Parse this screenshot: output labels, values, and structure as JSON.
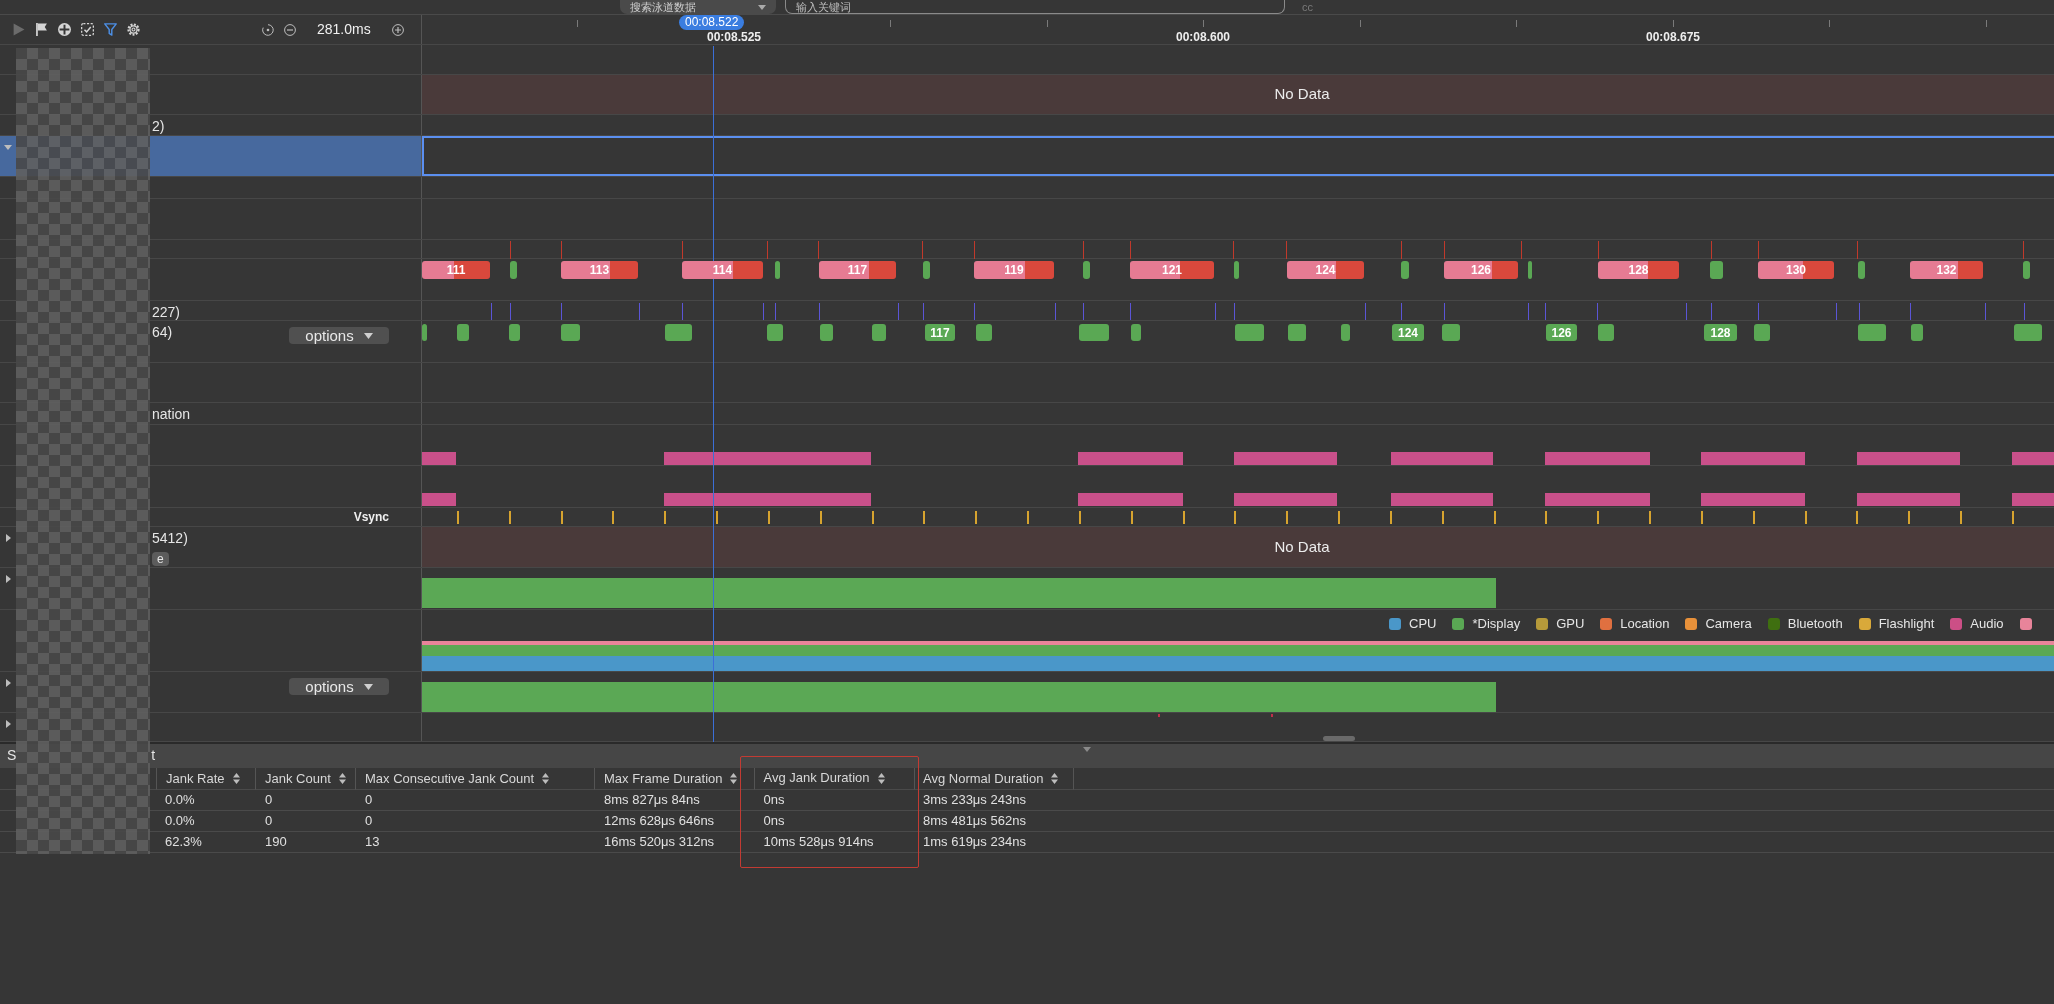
{
  "search_bar": {
    "lane_select": "搜索泳道数据",
    "keyword_field": {
      "placeholder": "输入关键词"
    },
    "trailing_text": "cc"
  },
  "toolbar": {
    "tools": [
      {
        "kind": "play",
        "disabled": true,
        "active": false
      },
      {
        "kind": "flag",
        "disabled": false,
        "active": false
      },
      {
        "kind": "crosshair",
        "disabled": false,
        "active": false
      },
      {
        "kind": "region_select",
        "disabled": false,
        "active": false
      },
      {
        "kind": "filter",
        "disabled": false,
        "active": true
      },
      {
        "kind": "settings",
        "disabled": false,
        "active": false
      }
    ],
    "zoom_reading": "281.0ms"
  },
  "timeline": {
    "cursor": "00:08.522",
    "ticks": [
      "00:08.525",
      "00:08.600",
      "00:08.675"
    ]
  },
  "tracks": [
    {
      "kind": "blank",
      "selected": false
    },
    {
      "kind": "no_data",
      "selected": false,
      "message": "No Data"
    },
    {
      "kind": "blank",
      "selected": false,
      "label": "2)"
    },
    {
      "kind": "blank",
      "selected": true,
      "expanded": true
    },
    {
      "kind": "blank",
      "selected": false
    },
    {
      "kind": "blank",
      "selected": false
    },
    {
      "kind": "red_ticks",
      "selected": false
    },
    {
      "kind": "split_slices",
      "selected": false,
      "slices": [
        {
          "kind": "jank",
          "label": "111"
        },
        {
          "kind": "normal"
        },
        {
          "kind": "jank",
          "label": "113"
        },
        {
          "kind": "jank",
          "label": "114"
        },
        {
          "kind": "normal"
        },
        {
          "kind": "jank",
          "label": "117"
        },
        {
          "kind": "normal"
        },
        {
          "kind": "jank",
          "label": "119"
        },
        {
          "kind": "normal"
        },
        {
          "kind": "jank",
          "label": "121"
        },
        {
          "kind": "normal"
        },
        {
          "kind": "jank",
          "label": "124"
        },
        {
          "kind": "normal"
        },
        {
          "kind": "jank",
          "label": "126"
        },
        {
          "kind": "normal"
        },
        {
          "kind": "jank",
          "label": "128"
        },
        {
          "kind": "normal"
        },
        {
          "kind": "jank",
          "label": "130"
        },
        {
          "kind": "normal"
        },
        {
          "kind": "jank",
          "label": "132"
        },
        {
          "kind": "normal"
        }
      ]
    },
    {
      "kind": "purple_ticks",
      "selected": false,
      "label": "227)"
    },
    {
      "kind": "green_slices",
      "selected": false,
      "label": "64)",
      "options": "options",
      "slices": [
        {
          "kind": "normal"
        },
        {
          "kind": "normal"
        },
        {
          "kind": "normal"
        },
        {
          "kind": "normal"
        },
        {
          "kind": "normal"
        },
        {
          "kind": "normal"
        },
        {
          "kind": "normal"
        },
        {
          "kind": "normal"
        },
        {
          "kind": "normal",
          "label": "117"
        },
        {
          "kind": "normal"
        },
        {
          "kind": "normal"
        },
        {
          "kind": "normal"
        },
        {
          "kind": "normal"
        },
        {
          "kind": "normal"
        },
        {
          "kind": "normal"
        },
        {
          "kind": "normal",
          "label": "124"
        },
        {
          "kind": "normal"
        },
        {
          "kind": "normal",
          "label": "126"
        },
        {
          "kind": "normal"
        },
        {
          "kind": "normal",
          "label": "128"
        },
        {
          "kind": "normal"
        },
        {
          "kind": "normal"
        },
        {
          "kind": "normal"
        },
        {
          "kind": "normal"
        }
      ]
    },
    {
      "kind": "blank",
      "selected": false
    },
    {
      "kind": "blank",
      "selected": false,
      "label": "nation"
    },
    {
      "kind": "pink_bars",
      "selected": false
    },
    {
      "kind": "pink_bars",
      "selected": false
    },
    {
      "kind": "vsync",
      "selected": false,
      "title": "Vsync"
    },
    {
      "kind": "no_data",
      "selected": false,
      "label": "5412)",
      "tag": "e",
      "expanded": false,
      "message": "No Data"
    },
    {
      "kind": "green_bar",
      "selected": false,
      "expanded": false
    },
    {
      "kind": "stacked",
      "selected": false,
      "legend": [
        {
          "label": "CPU",
          "color": "#4a97c9"
        },
        {
          "label": "*Display",
          "color": "#5aa854"
        },
        {
          "label": "GPU",
          "color": "#b69a3a"
        },
        {
          "label": "Location",
          "color": "#e07040"
        },
        {
          "label": "Camera",
          "color": "#e8913a"
        },
        {
          "label": "Bluetooth",
          "color": "#3f6f10"
        },
        {
          "label": "Flashlight",
          "color": "#d9a93a"
        },
        {
          "label": "Audio",
          "color": "#cc4f86"
        },
        {
          "color": "#e8849a"
        }
      ]
    },
    {
      "kind": "green_bar",
      "selected": false,
      "expanded": false,
      "options": "options"
    },
    {
      "kind": "markers",
      "selected": false,
      "expanded": false
    }
  ],
  "bottom_panel": {
    "tab_fragments": [
      "S",
      "t"
    ],
    "table": {
      "columns": [
        {
          "title": "Jank Rate",
          "highlighted": false
        },
        {
          "title": "Jank Count",
          "highlighted": false
        },
        {
          "title": "Max Consecutive Jank Count",
          "highlighted": false
        },
        {
          "title": "Max Frame Duration",
          "highlighted": false
        },
        {
          "title": "Avg Jank Duration",
          "highlighted": true
        },
        {
          "title": "Avg Normal Duration",
          "highlighted": false
        }
      ],
      "rows": [
        [
          "0.0%",
          "0",
          "0",
          "8ms 827μs 84ns",
          "0ns",
          "3ms 233μs 243ns"
        ],
        [
          "0.0%",
          "0",
          "0",
          "12ms 628μs 646ns",
          "0ns",
          "8ms 481μs 562ns"
        ],
        [
          "62.3%",
          "190",
          "13",
          "16ms 520μs 312ns",
          "10ms 528μs 914ns",
          "1ms 619μs 234ns"
        ]
      ]
    }
  }
}
